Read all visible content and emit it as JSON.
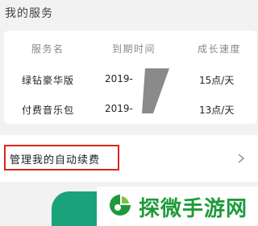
{
  "section": {
    "title": "我的服务"
  },
  "services": {
    "headers": {
      "name": "服务名",
      "expiry": "到期时间",
      "speed": "成长速度"
    },
    "rows": [
      {
        "name": "绿钻豪华版",
        "expiry": "2019-",
        "speed": "15点/天"
      },
      {
        "name": "付费音乐包",
        "expiry": "2019-",
        "speed": "13点/天"
      }
    ]
  },
  "manage": {
    "label": "管理我的自动续费"
  },
  "icons": {
    "chevron": "chevron-right-icon",
    "watermark_logo": "leaf-logo-icon"
  },
  "watermark": {
    "text": "探微手游网"
  },
  "colors": {
    "highlight_border": "#d9261c",
    "primary_green": "#1aa37a",
    "watermark_green": "#1f9a3a"
  }
}
